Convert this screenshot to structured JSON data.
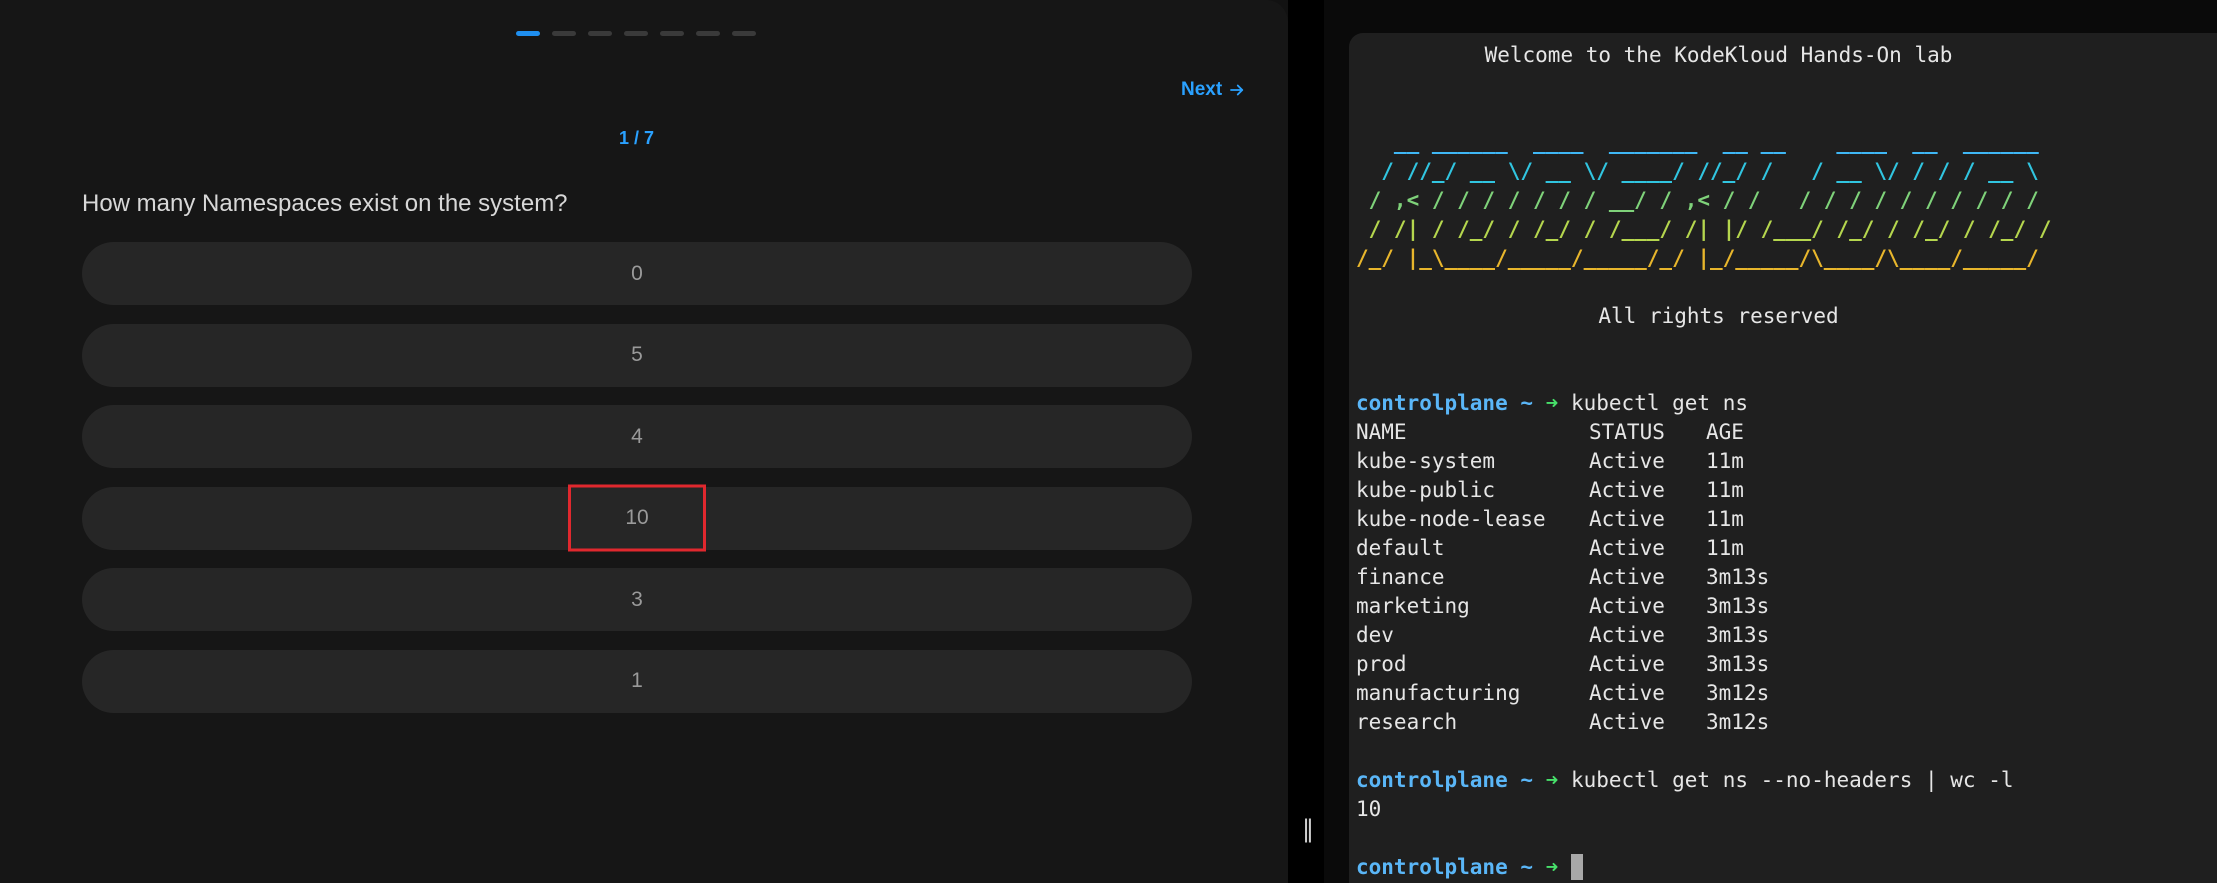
{
  "quiz": {
    "progress": {
      "total": 7,
      "current": 1
    },
    "next_label": "Next",
    "counter": "1 / 7",
    "question": "How many Namespaces exist on the system?",
    "options": [
      "0",
      "5",
      "4",
      "10",
      "3",
      "1"
    ],
    "highlighted_option": "10"
  },
  "terminal": {
    "welcome": "Welcome to the KodeKloud Hands-On lab",
    "banner": [
      "   __ ______  ____  _______  __ __    ____  __  ______",
      "  / //_/ __ \\/ __ \\/ ____/ //_/ /   / __ \\/ / / / __ \\",
      " / ,< / / / / / / / __/ / ,< / /   / / / / / / / / / /",
      " / /| / /_/ / /_/ / /___/ /| |/ /___/ /_/ / /_/ / /_/ /",
      "/_/ |_\\____/_____/_____/_/ |_/_____/\\____/\\____/_____/"
    ],
    "rights": "All rights reserved",
    "prompt_host": "controlplane ~",
    "prompt_arrow": "➜",
    "command1": "kubectl get ns",
    "headers": [
      "NAME",
      "STATUS",
      "AGE"
    ],
    "rows": [
      [
        "kube-system",
        "Active",
        "11m"
      ],
      [
        "kube-public",
        "Active",
        "11m"
      ],
      [
        "kube-node-lease",
        "Active",
        "11m"
      ],
      [
        "default",
        "Active",
        "11m"
      ],
      [
        "finance",
        "Active",
        "3m13s"
      ],
      [
        "marketing",
        "Active",
        "3m13s"
      ],
      [
        "dev",
        "Active",
        "3m13s"
      ],
      [
        "prod",
        "Active",
        "3m13s"
      ],
      [
        "manufacturing",
        "Active",
        "3m12s"
      ],
      [
        "research",
        "Active",
        "3m12s"
      ]
    ],
    "command2": "kubectl get ns --no-headers | wc -l",
    "output2": "10"
  },
  "divider": {
    "handle_glyph": "‖"
  },
  "colors": {
    "accent": "#2aa1ff",
    "highlight": "#e0282e",
    "prompt_host": "#5ab6f7",
    "prompt_arrow": "#47e06a"
  }
}
